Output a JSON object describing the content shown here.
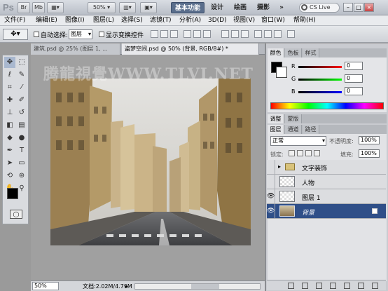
{
  "app": {
    "logo": "Ps",
    "zoom": "50%",
    "workspaces": [
      "基本功能",
      "设计",
      "绘画",
      "摄影"
    ],
    "more": "»",
    "cslive": "CS Live",
    "window_buttons": [
      "–",
      "□",
      "×"
    ]
  },
  "menu": [
    "文件(F)",
    "编辑(E)",
    "图像(I)",
    "图层(L)",
    "选择(S)",
    "滤镜(T)",
    "分析(A)",
    "3D(D)",
    "视图(V)",
    "窗口(W)",
    "帮助(H)"
  ],
  "options": {
    "auto_select_label": "自动选择:",
    "auto_select_value": "图层",
    "show_transform_label": "显示变换控件"
  },
  "tabs": [
    {
      "label": "建筑.psd @ 25% (图层 1, ..."
    },
    {
      "label": "盗梦空间.psd @ 50% (背景, RGB/8#) *"
    }
  ],
  "watermark": "腾龍視覺WWW.TLVI.NET",
  "status": {
    "zoom": "50%",
    "doc": "文档:2.02M/4.79M"
  },
  "color_panel": {
    "tabs": [
      "颜色",
      "色板",
      "样式"
    ],
    "channels": [
      {
        "label": "R",
        "value": "0",
        "color": "#d00000"
      },
      {
        "label": "G",
        "value": "0",
        "color": "#00b000"
      },
      {
        "label": "B",
        "value": "0",
        "color": "#0000d0"
      }
    ]
  },
  "adjust_panel": {
    "tabs": [
      "调整",
      "蒙版"
    ]
  },
  "layers_panel": {
    "tabs": [
      "图层",
      "通道",
      "路径"
    ],
    "blend_mode": "正常",
    "opacity_label": "不透明度:",
    "opacity_value": "100%",
    "lock_label": "锁定:",
    "fill_label": "填充:",
    "fill_value": "100%",
    "layers": [
      {
        "name": "文字装饰",
        "type": "group",
        "visible": false
      },
      {
        "name": "人物",
        "type": "layer",
        "visible": false
      },
      {
        "name": "图层 1",
        "type": "layer",
        "visible": true
      },
      {
        "name": "背景",
        "type": "background",
        "visible": true,
        "selected": true
      }
    ]
  }
}
